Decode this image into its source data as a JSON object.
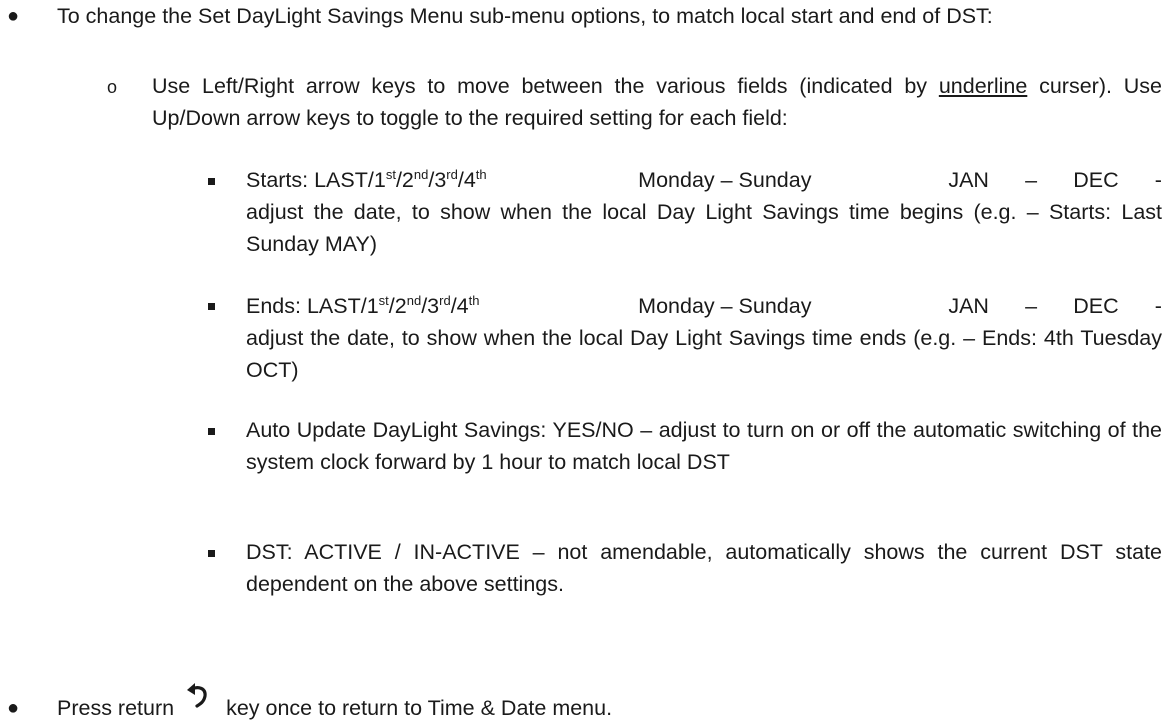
{
  "intro": {
    "text": "To change the Set DayLight Savings Menu sub-menu options, to match local start and end of DST:"
  },
  "nav": {
    "part1": "Use Left/Right arrow keys to move between the various fields (indicated by ",
    "underline_word": "underline",
    "part2": " curser). Use Up/Down arrow keys to toggle to the required setting for each field:"
  },
  "starts": {
    "label": "Starts: LAST/1",
    "s1": "st",
    "sep1": "/2",
    "s2": "nd",
    "sep2": "/3",
    "s3": "rd",
    "sep3": "/4",
    "s4": "th",
    "days": "Monday – Sunday",
    "jan": "JAN",
    "dash": "–",
    "dec": "DEC",
    "trail": "-",
    "desc": "adjust the date, to show when the local Day Light Savings time begins (e.g. – Starts: Last Sunday MAY)"
  },
  "ends": {
    "label": "Ends: LAST/1",
    "s1": "st",
    "sep1": "/2",
    "s2": "nd",
    "sep2": "/3",
    "s3": "rd",
    "sep3": "/4",
    "s4": "th",
    "days": "Monday – Sunday",
    "jan": "JAN",
    "dash": "–",
    "dec": "DEC",
    "trail": "-",
    "desc": "adjust the date, to show when the local Day Light Savings time ends (e.g. – Ends: 4th Tuesday OCT)"
  },
  "auto": {
    "text": "Auto Update DayLight Savings: YES/NO – adjust to turn on or off the automatic switching of the system clock forward by 1 hour to match local DST"
  },
  "dst": {
    "text": "DST: ACTIVE / IN-ACTIVE – not amendable, automatically shows the current DST state dependent on the above settings."
  },
  "press": {
    "before": "Press return",
    "icon": "return-arrow-icon",
    "after": "key once to return to Time & Date menu."
  }
}
